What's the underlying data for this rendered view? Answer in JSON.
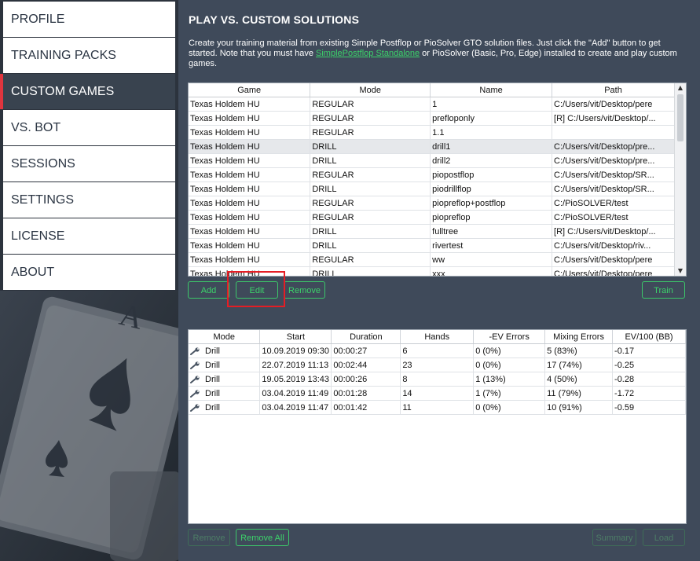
{
  "sidebar": {
    "items": [
      {
        "label": "PROFILE",
        "active": false
      },
      {
        "label": "TRAINING PACKS",
        "active": false
      },
      {
        "label": "CUSTOM GAMES",
        "active": true
      },
      {
        "label": "VS. BOT",
        "active": false
      },
      {
        "label": "SESSIONS",
        "active": false
      },
      {
        "label": "SETTINGS",
        "active": false
      },
      {
        "label": "LICENSE",
        "active": false
      },
      {
        "label": "ABOUT",
        "active": false
      }
    ]
  },
  "main": {
    "title": "PLAY VS. CUSTOM SOLUTIONS",
    "desc_part1": "Create your training material from existing Simple Postflop or PioSolver GTO solution files. Just click the \"Add\" button to get started. Note that you must have ",
    "desc_link": "SimplePostflop Standalone",
    "desc_part2": " or PioSolver (Basic, Pro, Edge) installed to create and play custom games."
  },
  "games_table": {
    "headers": [
      "Game",
      "Mode",
      "Name",
      "Path"
    ],
    "rows": [
      [
        "Texas Holdem HU",
        "REGULAR",
        "1",
        "C:/Users/vit/Desktop/pere"
      ],
      [
        "Texas Holdem HU",
        "REGULAR",
        "prefloponly",
        "[R] C:/Users/vit/Desktop/..."
      ],
      [
        "Texas Holdem HU",
        "REGULAR",
        "1.1",
        ""
      ],
      [
        "Texas Holdem HU",
        "DRILL",
        "drill1",
        "C:/Users/vit/Desktop/pre..."
      ],
      [
        "Texas Holdem HU",
        "DRILL",
        "drill2",
        "C:/Users/vit/Desktop/pre..."
      ],
      [
        "Texas Holdem HU",
        "REGULAR",
        "piopostflop",
        "C:/Users/vit/Desktop/SR..."
      ],
      [
        "Texas Holdem HU",
        "DRILL",
        "piodrillflop",
        "C:/Users/vit/Desktop/SR..."
      ],
      [
        "Texas Holdem HU",
        "REGULAR",
        "piopreflop+postflop",
        "C:/PioSOLVER/test"
      ],
      [
        "Texas Holdem HU",
        "REGULAR",
        "piopreflop",
        "C:/PioSOLVER/test"
      ],
      [
        "Texas Holdem HU",
        "DRILL",
        "fulltree",
        "[R] C:/Users/vit/Desktop/..."
      ],
      [
        "Texas Holdem HU",
        "DRILL",
        "rivertest",
        "C:/Users/vit/Desktop/riv..."
      ],
      [
        "Texas Holdem HU",
        "REGULAR",
        "ww",
        "C:/Users/vit/Desktop/pere"
      ],
      [
        "Texas Holdem HU",
        "DRILL",
        "xxx",
        "C:/Users/vit/Desktop/pere"
      ]
    ],
    "selected_row": 3
  },
  "top_buttons": {
    "add": "Add",
    "edit": "Edit",
    "remove": "Remove",
    "train": "Train"
  },
  "sessions_table": {
    "headers": [
      "Mode",
      "Start",
      "Duration",
      "Hands",
      "-EV Errors",
      "Mixing Errors",
      "EV/100 (BB)"
    ],
    "rows": [
      [
        "Drill",
        "10.09.2019 09:30",
        "00:00:27",
        "6",
        "0 (0%)",
        "5 (83%)",
        "-0.17"
      ],
      [
        "Drill",
        "22.07.2019 11:13",
        "00:02:44",
        "23",
        "0 (0%)",
        "17 (74%)",
        "-0.25"
      ],
      [
        "Drill",
        "19.05.2019 13:43",
        "00:00:26",
        "8",
        "1 (13%)",
        "4 (50%)",
        "-0.28"
      ],
      [
        "Drill",
        "03.04.2019 11:49",
        "00:01:28",
        "14",
        "1 (7%)",
        "11 (79%)",
        "-1.72"
      ],
      [
        "Drill",
        "03.04.2019 11:47",
        "00:01:42",
        "11",
        "0 (0%)",
        "10 (91%)",
        "-0.59"
      ]
    ]
  },
  "bottom_buttons": {
    "remove": "Remove",
    "remove_all": "Remove All",
    "summary": "Summary",
    "load": "Load"
  },
  "colors": {
    "accent_green": "#3cd26a",
    "active_marker": "#e0353e",
    "highlight_box": "#e51d24",
    "panel_bg": "#3f4a5a"
  }
}
